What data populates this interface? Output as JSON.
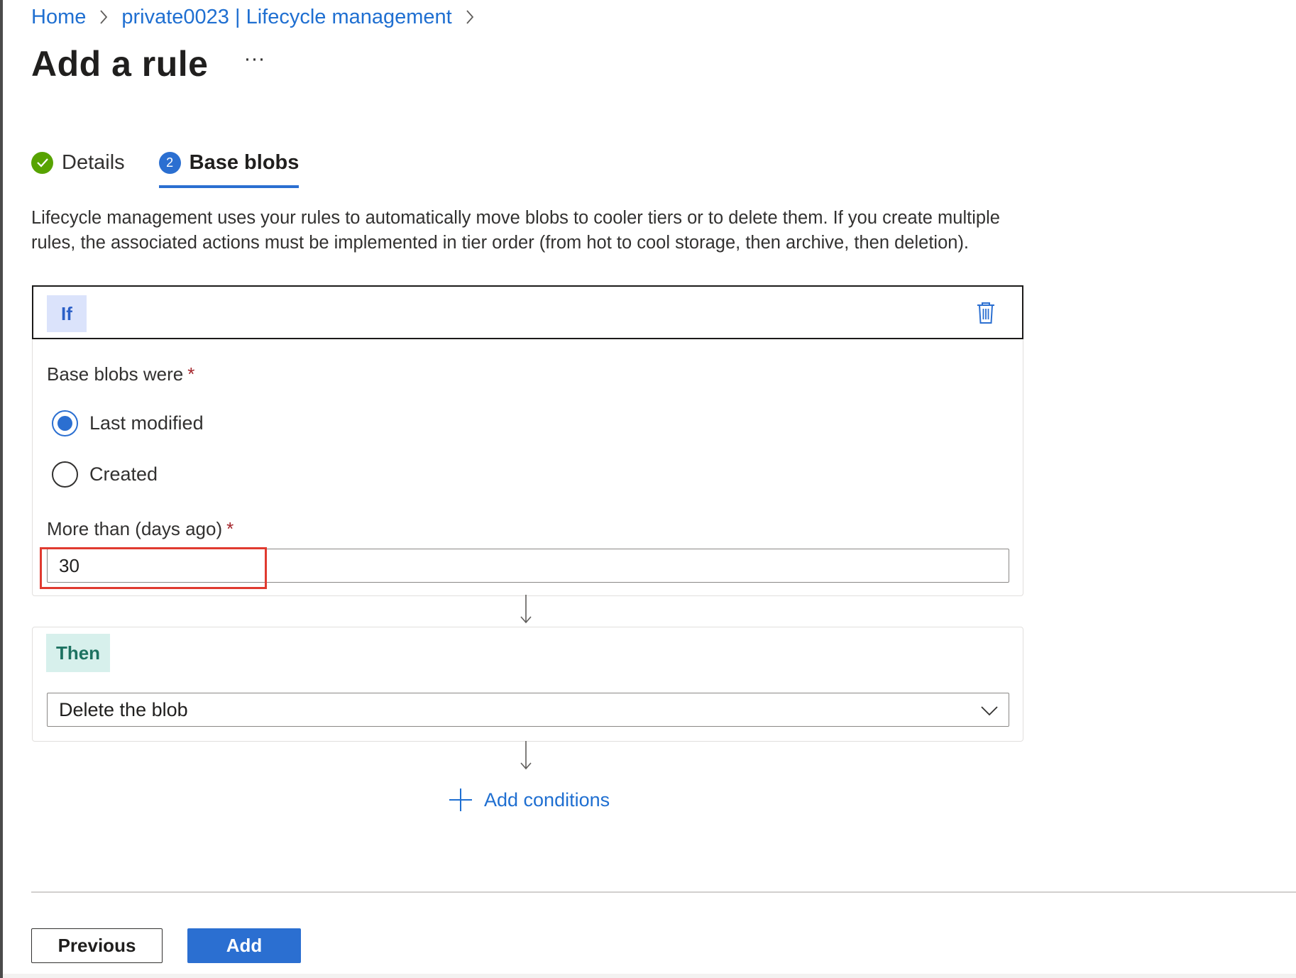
{
  "breadcrumb": {
    "items": [
      {
        "label": "Home"
      },
      {
        "label": "private0023 | Lifecycle management"
      }
    ]
  },
  "header": {
    "title": "Add a rule",
    "more_label": "···"
  },
  "tabs": [
    {
      "label": "Details",
      "state": "complete",
      "icon": "checkmark-icon"
    },
    {
      "label": "Base blobs",
      "step": "2",
      "state": "active"
    }
  ],
  "description": "Lifecycle management uses your rules to automatically move blobs to cooler tiers or to delete them. If you create multiple rules, the associated actions must be implemented in tier order (from hot to cool storage, then archive, then deletion).",
  "if_block": {
    "badge": "If",
    "base_blobs_label": "Base blobs were",
    "required_mark": "*",
    "options": [
      {
        "label": "Last modified",
        "selected": true
      },
      {
        "label": "Created",
        "selected": false
      }
    ],
    "days_label": "More than (days ago)",
    "days_value": "30"
  },
  "then_block": {
    "badge": "Then",
    "action_selected": "Delete the blob"
  },
  "add_conditions_label": "Add conditions",
  "footer": {
    "previous_label": "Previous",
    "add_label": "Add"
  },
  "colors": {
    "accent": "#2b6fd1",
    "success": "#57a300",
    "highlight": "#e03a2f",
    "if_badge_bg": "#dbe3fb",
    "then_badge_bg": "#d7f0ec"
  }
}
